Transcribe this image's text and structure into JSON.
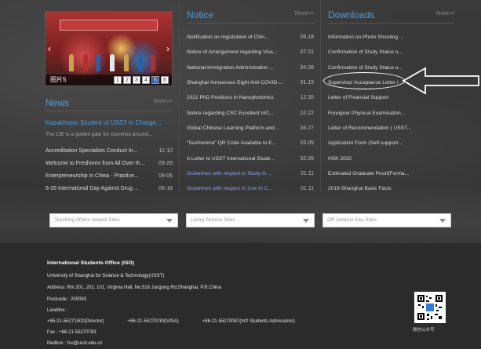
{
  "slider": {
    "caption": "图片5",
    "pages": [
      "1",
      "2",
      "3",
      "4",
      "5",
      "6"
    ],
    "active_page": "5"
  },
  "news": {
    "title": "News",
    "more": "More>>",
    "feature_title": "Kazakhstan Student of USST in Charge...",
    "feature_sub": "The CIE is a golden gate for countries around...",
    "items": [
      {
        "title": "Accreditation Specialists Conduct In...",
        "date": "11-10"
      },
      {
        "title": "Welcome to Freshmen from All Over th...",
        "date": "09-28"
      },
      {
        "title": "Enterpreneurship in China - Practice...",
        "date": "08-06"
      },
      {
        "title": "6-26 International Day Against Drug ...",
        "date": "06-18"
      }
    ]
  },
  "notice": {
    "title": "Notice",
    "more": "More>>",
    "items": [
      {
        "title": "Notification on registration of Chin...",
        "date": "09.18"
      },
      {
        "title": "Notice of Arrangement regarding Visa...",
        "date": "07.01"
      },
      {
        "title": "National Immigration Administration ...",
        "date": "04.08"
      },
      {
        "title": "Shanghai Announces Eight Anti-COVID-...",
        "date": "01.15"
      },
      {
        "title": "2021 PhD Positions in Nanophotonics",
        "date": "12.30"
      },
      {
        "title": "Notice regarding CSC Excellent Int'l...",
        "date": "10.22"
      },
      {
        "title": "Global Chinese Learning Platform and...",
        "date": "04.27"
      },
      {
        "title": "\"Suishenma\" QR Code Available to E...",
        "date": "03.05"
      },
      {
        "title": "A Letter to USST International Stude...",
        "date": "02.06"
      },
      {
        "title": "Guidelines with respect to Study In ...",
        "date": "01.11"
      },
      {
        "title": "Guidelines with respect to Live In C...",
        "date": "01.11"
      }
    ]
  },
  "downloads": {
    "title": "Downloads",
    "more": "More>>",
    "items": [
      "Information on Photo Shooting ...",
      "Confirmation of Study Status o...",
      "Confirmation of Study Status o...",
      "Supervisor Acceptance Letter ( ...",
      "Letter of Financial Support",
      "Foreigner Physical Examination...",
      "Letter of Recommendation ( USST...",
      "Application Form (Self-support...",
      "HSK 2020",
      "Estimated Graduate Proof(Forma...",
      "2019-Shanghai Basic Facts"
    ]
  },
  "dropdowns": {
    "teaching": "Teaching Affairs related Sites",
    "living": "Living Service Sites",
    "offcampus": "Off-campus Key Sites"
  },
  "footer": {
    "office": "International Students Office (ISO)",
    "university": "University of Shanghai for Science & Technology(USST)",
    "address": "Address: Rm.201, 202, 101, Virginia Hall, No.516 Jungong Rd,Shanghai, P.R.China",
    "postcode": "Postcode : 200093",
    "landline": "Landline :",
    "phone1": "+86-21-55271502(Director)",
    "phone2": "+86-21-55270783(VISA)",
    "phone3": "+86-21-55270087(Int'l Students Admissions)",
    "fax": "Fax : +86-21-55270783",
    "mailbox": "Mailbox : fso@usst.edu.cn",
    "qr_caption": "微信公众号"
  }
}
